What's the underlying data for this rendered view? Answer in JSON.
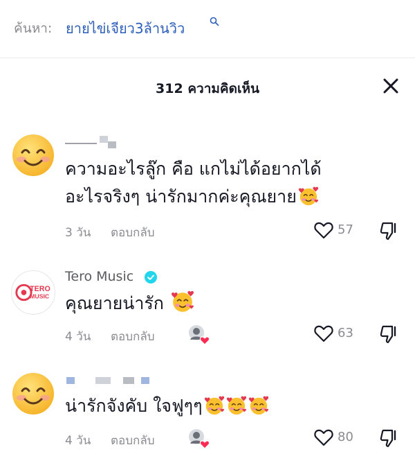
{
  "search": {
    "prefix": "ค้นหา:",
    "query": "ยายไข่เจียว3ล้านวิว"
  },
  "header": {
    "comment_count": "312 ความคิดเห็น"
  },
  "comments": [
    {
      "avatar": "smiling-face-emoji",
      "username": "",
      "text_line1": "ความอะไรลู๊ก คือ แกไม่ได้อยากได้",
      "text_line2": "อะไรจริงๆ น่ารักมากค่ะคุณยาย",
      "emoji": "smiling-face-with-hearts",
      "time": "3 วัน",
      "reply": "ตอบกลับ",
      "likes": "57"
    },
    {
      "avatar": "tero-music-logo",
      "logo_text_line1": "TERO",
      "logo_text_line2": "MUSIC",
      "username": "Tero Music",
      "verified": true,
      "text": "คุณยายน่ารัก ",
      "emoji": "smiling-face-with-hearts",
      "time": "4 วัน",
      "reply": "ตอบกลับ",
      "creator_liked": true,
      "likes": "63"
    },
    {
      "avatar": "smiling-face-emoji",
      "username": "",
      "text": "น่ารักจังคับ ใจฟูๆๆ",
      "emoji_count": 3,
      "time": "4 วัน",
      "reply": "ตอบกลับ",
      "creator_liked": true,
      "likes": "80"
    }
  ],
  "colors": {
    "link": "#2b5db9",
    "muted": "#8a8b91",
    "verified": "#20d5ec",
    "heart": "#fe2c55"
  }
}
